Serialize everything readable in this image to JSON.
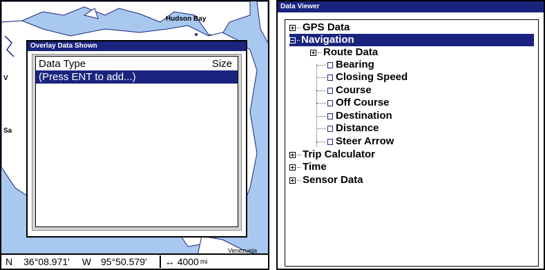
{
  "map": {
    "labels": {
      "hudson_bay": "Hudson Bay",
      "venezuela": "Venezuela",
      "left_partial_1": "V",
      "left_partial_2": "Sa"
    },
    "status": {
      "lat_hemi": "N",
      "lat": "36°08.971'",
      "lon_hemi": "W",
      "lon": "95°50.579'",
      "range_icon": "↔",
      "range_value": "4000",
      "range_unit": "mi"
    }
  },
  "overlay_dialog": {
    "title": "Overlay Data Shown",
    "col_type": "Data Type",
    "col_size": "Size",
    "rows": [
      "(Press ENT to add...)"
    ]
  },
  "data_viewer": {
    "title": "Data Viewer",
    "tree": {
      "gps_data": "GPS Data",
      "navigation": "Navigation",
      "route_data": "Route Data",
      "bearing": "Bearing",
      "closing_speed": "Closing Speed",
      "course": "Course",
      "off_course": "Off Course",
      "destination": "Destination",
      "distance": "Distance",
      "steer_arrow": "Steer Arrow",
      "trip_calculator": "Trip Calculator",
      "time": "Time",
      "sensor_data": "Sensor Data"
    }
  },
  "colors": {
    "title_bar": "#1a237e",
    "water": "#a8c8f0",
    "land": "#ffffff"
  }
}
